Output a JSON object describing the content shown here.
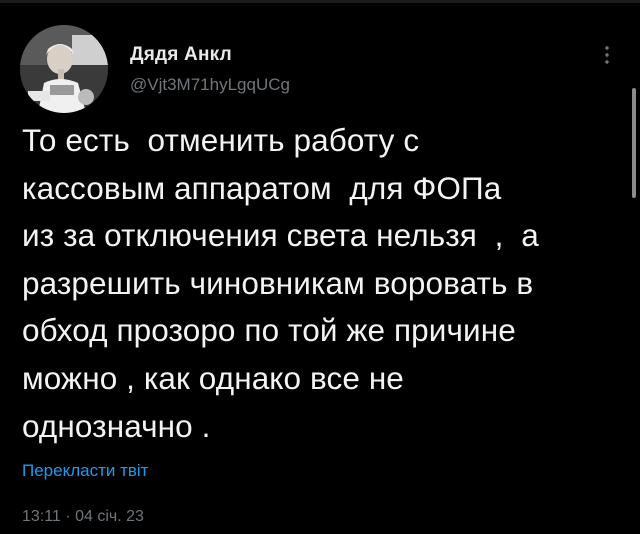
{
  "tweet": {
    "author": {
      "display_name": "Дядя Анкл",
      "handle": "@Vjt3M71hyLgqUCg"
    },
    "more_icon": "more-vertical-icon",
    "text": "То есть  отменить работу с\nкассовым аппаратом  для ФОПа\nиз за отключения света нельзя  ,  а\nразрешить чиновникам воровать в\nобход прозоро по той же причине\nможно , как однако все не\nоднозначно .",
    "translate_label": "Перекласти твіт",
    "timestamp": "13:11 · 04 січ. 23"
  },
  "colors": {
    "background": "#000000",
    "text": "#e7e9ea",
    "secondary": "#71767b",
    "accent": "#1d9bf0"
  }
}
